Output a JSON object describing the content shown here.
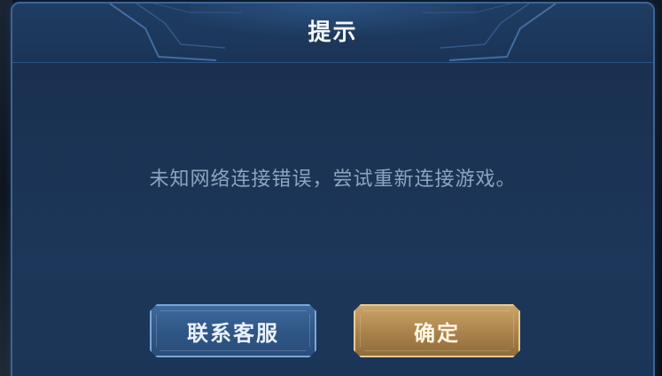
{
  "dialog": {
    "title": "提示",
    "message": "未知网络连接错误，尝试重新连接游戏。"
  },
  "buttons": {
    "contact_support_label": "联系客服",
    "confirm_label": "确定"
  },
  "colors": {
    "dialog_bg": "#1b3252",
    "border": "#3d6596",
    "secondary_button": "#2e5584",
    "primary_button": "#a9824b",
    "message_text": "#8ea3be",
    "title_text": "#f3f6fb"
  }
}
